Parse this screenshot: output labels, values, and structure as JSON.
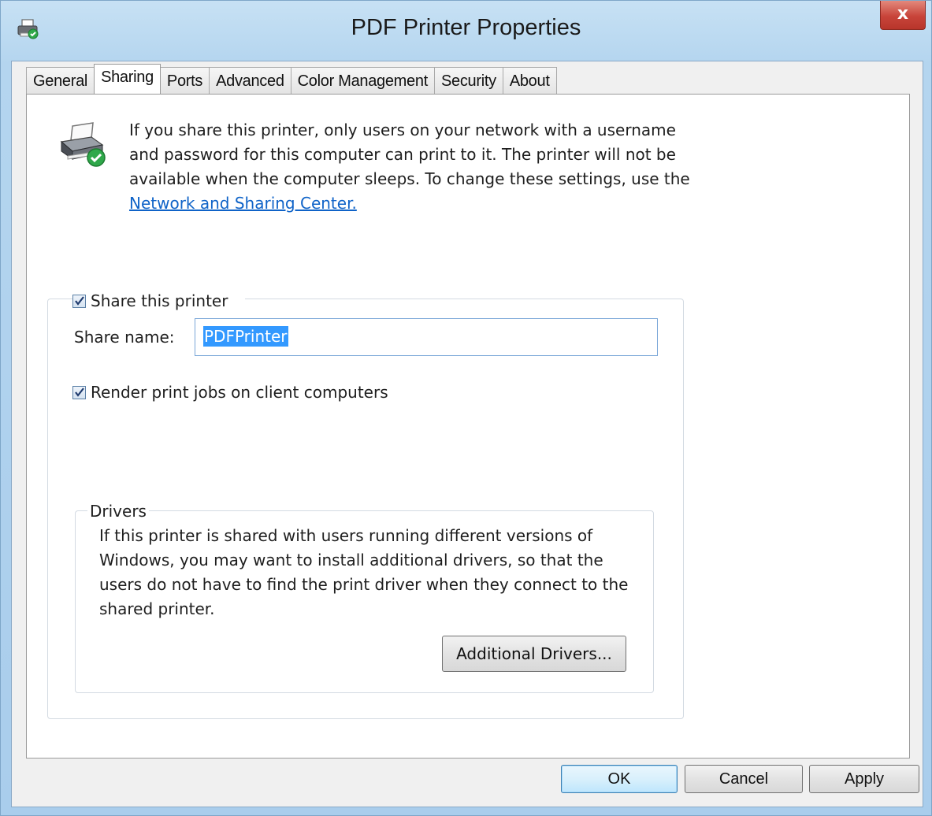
{
  "window": {
    "title": "PDF Printer Properties",
    "close_label": "x"
  },
  "tabs": [
    {
      "label": "General",
      "active": false
    },
    {
      "label": "Sharing",
      "active": true
    },
    {
      "label": "Ports",
      "active": false
    },
    {
      "label": "Advanced",
      "active": false
    },
    {
      "label": "Color Management",
      "active": false
    },
    {
      "label": "Security",
      "active": false
    },
    {
      "label": "About",
      "active": false
    }
  ],
  "sharing": {
    "info_text": "If you share this printer, only users on your network with a username and password for this computer can print to it. The printer will not be available when the computer sleeps. To change these settings, use the",
    "link_text": "Network and Sharing Center.",
    "share_checkbox": {
      "label": "Share this printer",
      "checked": true
    },
    "share_name_label": "Share name:",
    "share_name_value": "PDFPrinter",
    "render_checkbox": {
      "label": "Render print jobs on client computers",
      "checked": true
    }
  },
  "drivers": {
    "legend": "Drivers",
    "text": "If this printer is shared with users running different versions of Windows, you may want to install additional drivers, so that the users do not have to find the print driver when they connect to the shared printer.",
    "button_label": "Additional Drivers..."
  },
  "footer": {
    "ok_label": "OK",
    "cancel_label": "Cancel",
    "apply_label": "Apply"
  },
  "icons": {
    "title": "printer-check-icon",
    "panel": "printer-shared-icon"
  },
  "colors": {
    "link": "#0f63c8",
    "selection": "#3399ff",
    "close": "#c8443a"
  }
}
